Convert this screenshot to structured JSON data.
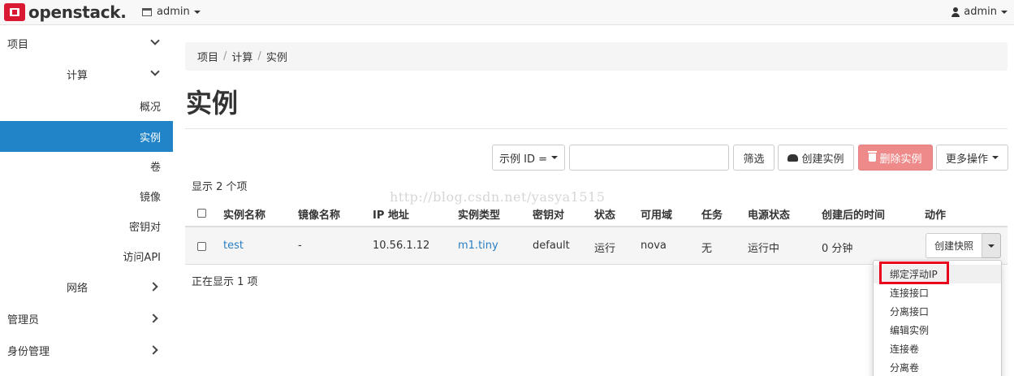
{
  "brand": {
    "logo_text": "openstack."
  },
  "header": {
    "project_label": "admin",
    "user_label": "admin"
  },
  "sidebar": {
    "project": "项目",
    "compute": "计算",
    "items": [
      "概况",
      "实例",
      "卷",
      "镜像",
      "密钥对",
      "访问API"
    ],
    "active": "实例",
    "network": "网络",
    "admin": "管理员",
    "identity": "身份管理"
  },
  "breadcrumb": [
    "项目",
    "计算",
    "实例"
  ],
  "page_title": "实例",
  "toolbar": {
    "filter_select": "示例 ID =",
    "filter_value": "",
    "filter_button": "筛选",
    "create_button": "创建实例",
    "delete_button": "删除实例",
    "more_button": "更多操作"
  },
  "table": {
    "count_text": "显示 2 个项",
    "columns": [
      "实例名称",
      "镜像名称",
      "IP 地址",
      "实例类型",
      "密钥对",
      "状态",
      "可用域",
      "任务",
      "电源状态",
      "创建后的时间",
      "动作"
    ],
    "rows": [
      {
        "name": "test",
        "image": "-",
        "ip": "10.56.1.12",
        "flavor": "m1.tiny",
        "keypair": "default",
        "status": "运行",
        "zone": "nova",
        "task": "无",
        "power": "运行中",
        "age": "0 分钟",
        "action": "创建快照"
      }
    ],
    "footer_text": "正在显示 1 项"
  },
  "action_menu": [
    "绑定浮动IP",
    "连接接口",
    "分离接口",
    "编辑实例",
    "连接卷",
    "分离卷"
  ],
  "watermark": "http://blog.csdn.net/yasya1515",
  "colors": {
    "active": "#2184c9",
    "danger": "#ee8a8a",
    "highlight": "#e8001c",
    "link": "#2a7ec1"
  }
}
